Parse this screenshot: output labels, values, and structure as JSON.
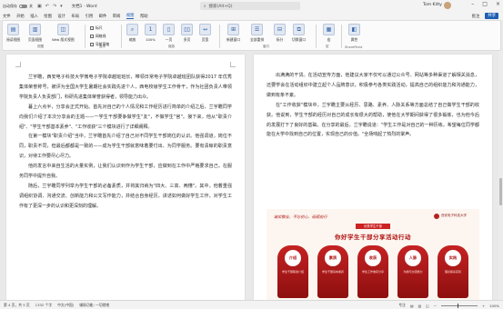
{
  "titlebar": {
    "autosave_label": "自动保存",
    "autosave_state": "关",
    "doc_name": "文档1 - Word",
    "search_placeholder": "搜索(Alt+Q)",
    "user_name": "Tom Kitty",
    "icons": [
      "save-icon",
      "undo-icon",
      "redo-icon",
      "customize-icon"
    ]
  },
  "tabs": {
    "items": [
      "文件",
      "开始",
      "插入",
      "绘图",
      "设计",
      "布局",
      "引用",
      "邮件",
      "审阅",
      "视图",
      "帮助"
    ],
    "active": "视图",
    "comments_label": "批注",
    "share_label": "共享"
  },
  "ribbon": {
    "views": [
      {
        "icon": "read-mode-icon",
        "label": "阅读视图"
      },
      {
        "icon": "print-layout-icon",
        "label": "页面视图"
      },
      {
        "icon": "web-layout-icon",
        "label": "Web 版式视图"
      }
    ],
    "views_group": "视图",
    "checks": [
      {
        "label": "标尺",
        "checked": false
      },
      {
        "label": "网格线",
        "checked": false
      },
      {
        "label": "导航窗格",
        "checked": false
      }
    ],
    "show_group": "显示",
    "zoom_buttons": [
      {
        "icon": "zoom-icon",
        "label": "缩放"
      },
      {
        "icon": "100-icon",
        "label": "100%"
      },
      {
        "icon": "one-page-icon",
        "label": "一页"
      },
      {
        "icon": "multi-page-icon",
        "label": "多页"
      },
      {
        "icon": "page-width-icon",
        "label": "页宽"
      }
    ],
    "zoom_group": "缩放",
    "window_buttons": [
      {
        "icon": "new-window-icon",
        "label": "新建窗口"
      },
      {
        "icon": "arrange-icon",
        "label": "全部重排"
      },
      {
        "icon": "split-icon",
        "label": "拆分"
      },
      {
        "icon": "switch-window-icon",
        "label": "切换窗口"
      }
    ],
    "window_group": "窗口",
    "macros": {
      "icon": "macro-icon",
      "label": "宏"
    },
    "macros_group": "宏",
    "sharepoint": {
      "icon": "properties-icon",
      "label": "属性"
    },
    "sharepoint_group": "SharePoint"
  },
  "page_left": {
    "paragraphs": [
      "兰宇瞻，西安电子科技大学微电子学院卓越班班长，带领日常电子学院卓越班团队获得2017 年优秀集体荣誉称号，被评为全国大学生暑期社会实践先进个人，西电校级学生工作骨干，作为社团负责人带领学院负责人负责部门，科研先进集体荣誉获得者，领导能力出众。",
      "暮上六点半，分享会正式开始。首先对自己的个人情况和工作经历进行简单的介绍之后，兰宇瞻同学向我们介绍了本次分享会的主题——一学生干部要争做学生\"友\"，不做学生\"官\"。接下来，他从\"职责介绍\"、\"学生干部基本素养\"、\"工作收获\"三个模块进行了详细阐释。",
      "在第一模块\"职责介绍\"当中，兰宇瞻首先介绍了自己对不同学生干部岗位的认识。他强调道，岗位不同，职责不同，但最后都都是一致的——成为学生干部就意味着要付出、为同学服务。要有清晰的职责意识，对待工作要尽心尽力。",
      "他的发言中来自生活的大量实例，让我们认识到作为学生干部，应做到在工作中严格要求自己，在服务同学中提升自我。",
      "随后，兰宇瞻同学列举为学生干部的必备素质，并将其归纳为\"四大、三高、两懂\"。其中，他着重强调组织协调、沟通交流、创新能力和公文写作能力，并结合自身经历，讲述如何做好学生工作，对学生工作有了更深一步的认识和更深刻的理解。"
    ]
  },
  "page_right": {
    "paragraphs": [
      "出满满的干货。在活动宣传方面，他建议大家不仅可以通过公众号、网站等多种渠道了解相关消息，还要学会在活动组织中建立起个人品牌意识，积极参与各类实践活动，提高自己的组织能力和沟通能力，做到有条不紊。",
      "在\"工作收获\"模块中，兰宇瞻主要从经历、思路、素养、人脉关系等方面总结了自己做学生干部的收获。他说到，学生干部的经历对自己的成长有很大的帮助，使他在大学期间获得了很多锻炼，也为他今后的发展打下了良好的基础。在分享的最后，兰宇瞻说道：\"学生工作是对自己的一种历练，希望每位同学都能在大学中找到自己的位置，实现自己的价值。\"全场响起了热烈的掌声。"
    ]
  },
  "poster": {
    "top_slogan": "诚实敬业、不忘初心、砥砺前行",
    "emblem": "西安电子科技大学",
    "banner": "优秀学生干部",
    "title": "你好学生干部分享活动行动",
    "cards": [
      {
        "head": "介绍",
        "text": "学生干部职责介绍"
      },
      {
        "head": "素质",
        "text": "学生干部基本素养"
      },
      {
        "head": "收获",
        "text": "学生工作收获分享"
      },
      {
        "head": "人脉",
        "text": "沟通与交流能力"
      },
      {
        "head": "实践",
        "text": "理论联系实际"
      }
    ]
  },
  "statusbar": {
    "page": "第 4 页，共 5 页",
    "words": "1332 个字",
    "language": "中文(中国)",
    "accessibility": "辅助功能: 一切就绪",
    "focus": "专注",
    "zoom": "100%",
    "zoom_level": 0.5
  }
}
